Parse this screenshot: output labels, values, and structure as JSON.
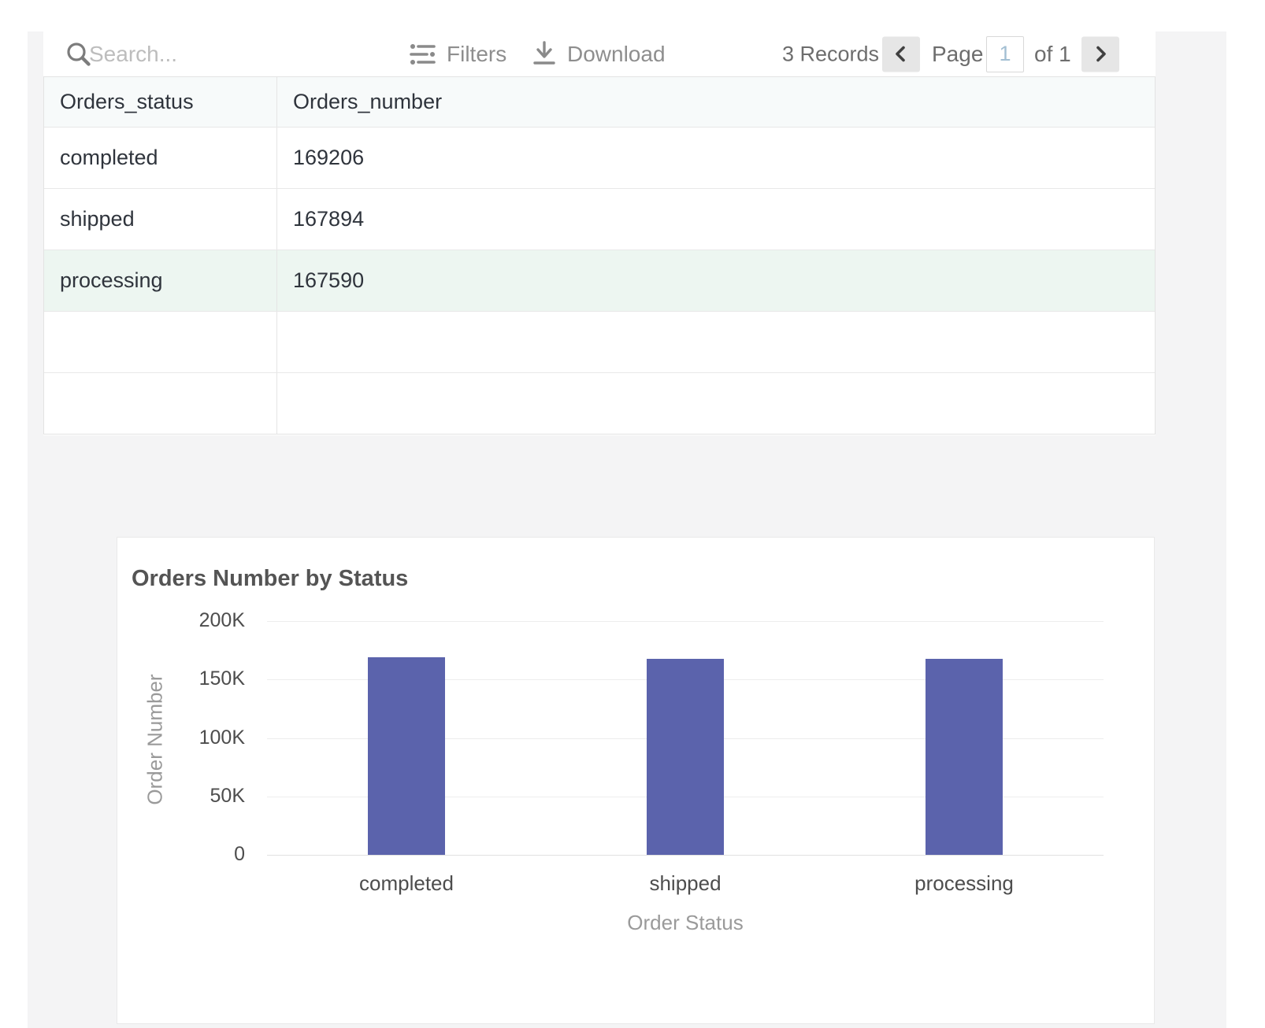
{
  "toolbar": {
    "search_placeholder": "Search...",
    "filters_label": "Filters",
    "download_label": "Download",
    "records_text": "3 Records",
    "page_label": "Page",
    "page_value": "1",
    "of_label": "of 1"
  },
  "table": {
    "columns": [
      "Orders_status",
      "Orders_number"
    ],
    "rows": [
      {
        "status": "completed",
        "number": "169206",
        "highlighted": false
      },
      {
        "status": "shipped",
        "number": "167894",
        "highlighted": false
      },
      {
        "status": "processing",
        "number": "167590",
        "highlighted": true
      }
    ]
  },
  "chart_data": {
    "type": "bar",
    "title": "Orders Number by Status",
    "categories": [
      "completed",
      "shipped",
      "processing"
    ],
    "values": [
      169206,
      167894,
      167590
    ],
    "xlabel": "Order Status",
    "ylabel": "Order Number",
    "ylim": [
      0,
      200000
    ],
    "yticks": [
      0,
      50000,
      100000,
      150000,
      200000
    ],
    "ytick_labels": [
      "0",
      "50K",
      "100K",
      "150K",
      "200K"
    ],
    "grid": true,
    "legend": "none",
    "bar_color": "#5b63ac"
  },
  "icons": {
    "search": "magnifier",
    "filters": "sliders",
    "download": "download-arrow",
    "prev": "chevron-left",
    "next": "chevron-right"
  },
  "colors": {
    "bar": "#5b63ac",
    "row_highlight": "#edf6f1",
    "header_bg": "#f7fafa",
    "page_bg": "#f4f4f5",
    "border": "#e4e4e4"
  }
}
